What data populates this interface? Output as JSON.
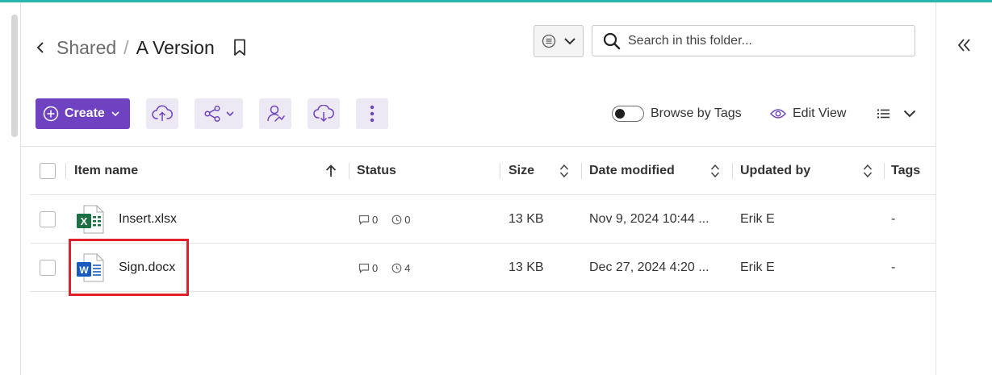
{
  "breadcrumb": {
    "parent": "Shared",
    "separator": "/",
    "current": "A Version"
  },
  "search": {
    "placeholder": "Search in this folder..."
  },
  "toolbar": {
    "create_label": "Create"
  },
  "view": {
    "browse_by_tags_label": "Browse by Tags",
    "edit_view_label": "Edit View"
  },
  "table": {
    "headers": {
      "item_name": "Item name",
      "status": "Status",
      "size": "Size",
      "date_modified": "Date modified",
      "updated_by": "Updated by",
      "tags": "Tags"
    },
    "rows": [
      {
        "name": "Insert.xlsx",
        "type": "excel",
        "comments": "0",
        "versions": "0",
        "size": "13 KB",
        "date_modified": "Nov 9, 2024 10:44 ...",
        "updated_by": "Erik E",
        "tags": "-"
      },
      {
        "name": "Sign.docx",
        "type": "word",
        "comments": "0",
        "versions": "4",
        "size": "13 KB",
        "date_modified": "Dec 27, 2024 4:20 ...",
        "updated_by": "Erik E",
        "tags": "-"
      }
    ]
  },
  "colors": {
    "accent": "#6f42c1",
    "accent_light": "#ece8f4",
    "top_line": "#2ab5b0",
    "highlight": "#e0202a",
    "excel": "#1d7044",
    "word": "#185abd"
  }
}
